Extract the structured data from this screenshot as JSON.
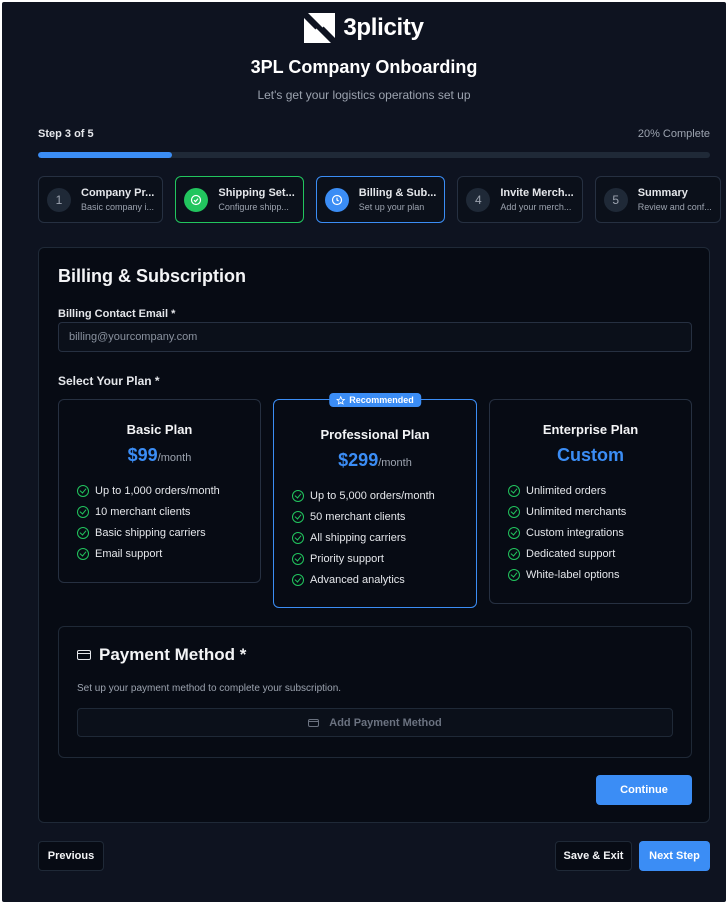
{
  "brand": {
    "name": "3plicity",
    "logo_icon": "3plicity-logo-icon"
  },
  "header": {
    "title": "3PL Company Onboarding",
    "subtitle": "Let's get your logistics operations set up"
  },
  "progress": {
    "step_text": "Step 3 of 5",
    "percent_text": "20% Complete",
    "percent_value": 20,
    "fill_color": "#3b8df5"
  },
  "steps": [
    {
      "number": "1",
      "title": "Company Pr...",
      "subtitle": "Basic company i...",
      "state": "pending"
    },
    {
      "number": "",
      "title": "Shipping Set...",
      "subtitle": "Configure shipp...",
      "state": "done",
      "icon": "check-circle-icon"
    },
    {
      "number": "",
      "title": "Billing & Sub...",
      "subtitle": "Set up your plan",
      "state": "active",
      "icon": "clock-icon"
    },
    {
      "number": "4",
      "title": "Invite Merch...",
      "subtitle": "Add your merch...",
      "state": "pending"
    },
    {
      "number": "5",
      "title": "Summary",
      "subtitle": "Review and conf...",
      "state": "pending"
    }
  ],
  "billing": {
    "title": "Billing & Subscription",
    "email_label": "Billing Contact Email *",
    "email_placeholder": "billing@yourcompany.com",
    "email_value": "",
    "plan_label": "Select Your Plan *"
  },
  "plans": [
    {
      "name": "Basic Plan",
      "price": "$99",
      "period": "/month",
      "recommended": false,
      "features": [
        "Up to 1,000 orders/month",
        "10 merchant clients",
        "Basic shipping carriers",
        "Email support"
      ]
    },
    {
      "name": "Professional Plan",
      "price": "$299",
      "period": "/month",
      "recommended": true,
      "badge": "Recommended",
      "features": [
        "Up to 5,000 orders/month",
        "50 merchant clients",
        "All shipping carriers",
        "Priority support",
        "Advanced analytics"
      ]
    },
    {
      "name": "Enterprise Plan",
      "price": "Custom",
      "period": "",
      "recommended": false,
      "features": [
        "Unlimited orders",
        "Unlimited merchants",
        "Custom integrations",
        "Dedicated support",
        "White-label options"
      ]
    }
  ],
  "payment": {
    "title": "Payment Method *",
    "description": "Set up your payment method to complete your subscription.",
    "add_button": "Add Payment Method",
    "icon": "credit-card-icon"
  },
  "actions": {
    "continue": "Continue",
    "previous": "Previous",
    "save_exit": "Save & Exit",
    "next": "Next Step"
  },
  "colors": {
    "accent": "#3b8df5",
    "success": "#22c55e",
    "background": "#0e1320"
  }
}
